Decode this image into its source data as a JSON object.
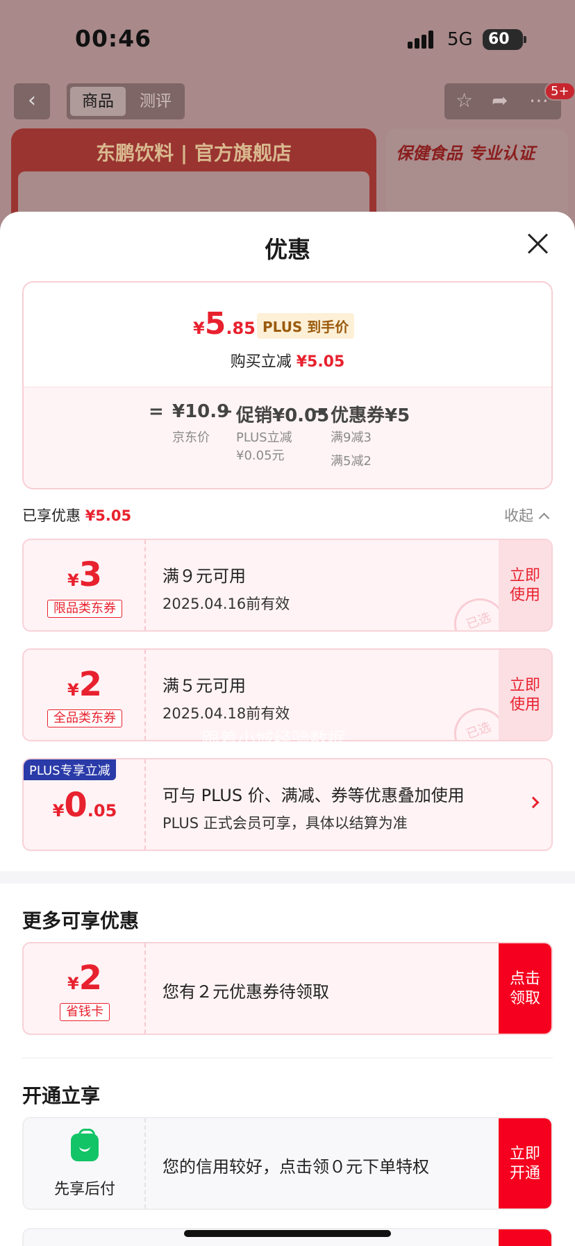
{
  "status_bar": {
    "time": "00:46",
    "network": "5G",
    "battery": "60"
  },
  "top_nav": {
    "back_icon": "chevron-left-icon",
    "tabs": [
      "商品",
      "测评"
    ],
    "badge": "5+"
  },
  "background": {
    "store_title": "东鹏饮料 | 官方旗舰店",
    "promo_title": "保健食品 专业认证"
  },
  "sheet": {
    "title": "优惠",
    "summary": {
      "price_symbol": "¥",
      "price_int": "5",
      "price_dec": ".85",
      "price_tag": "PLUS 到手价",
      "reduce_label": "购买立减",
      "reduce_value": "¥5.05",
      "formula": [
        {
          "op": "=",
          "main": "¥10.9",
          "sub": [
            "京东价"
          ]
        },
        {
          "op": "−",
          "main": "促销¥0.05",
          "sub": [
            "PLUS立减",
            "¥0.05元"
          ]
        },
        {
          "op": "−",
          "main": "优惠券¥5",
          "sub": [
            "满9减3",
            "满5减2"
          ]
        }
      ]
    },
    "enjoyed": {
      "label": "已享优惠",
      "value": "¥5.05",
      "collapse": "收起"
    },
    "coupons": [
      {
        "symbol": "¥",
        "amount": "3",
        "dec": "",
        "tag": "限品类东券",
        "title": "满９元可用",
        "sub": "2025.04.16前有效",
        "action": "立即\n使用",
        "stamp": "已选"
      },
      {
        "symbol": "¥",
        "amount": "2",
        "dec": "",
        "tag": "全品类东券",
        "title": "满５元可用",
        "sub": "2025.04.18前有效",
        "action": "立即\n使用",
        "stamp": "已选"
      }
    ],
    "plus_card": {
      "flag": "PLUS专享立减",
      "symbol": "¥",
      "amount": "0",
      "dec": ".05",
      "title": "可与 PLUS 价、满减、券等优惠叠加使用",
      "sub": "PLUS 正式会员可享，具体以结算为准"
    },
    "more_section": {
      "title": "更多可享优惠",
      "card": {
        "symbol": "¥",
        "amount": "2",
        "tag": "省钱卡",
        "title": "您有２元优惠券待领取",
        "action": "点击\n领取"
      }
    },
    "open_section": {
      "title": "开通立享",
      "card": {
        "icon": "shopping-bag-icon",
        "label": "先享后付",
        "title": "您的信用较好，点击领０元下单特权",
        "action": "立即\n开通"
      }
    },
    "watermark": "跟着小城经验数据"
  },
  "colors": {
    "accent": "#e8212e",
    "action_solid": "#f5001e",
    "plus_blue": "#2a3aa8",
    "pay_green": "#13c466"
  }
}
